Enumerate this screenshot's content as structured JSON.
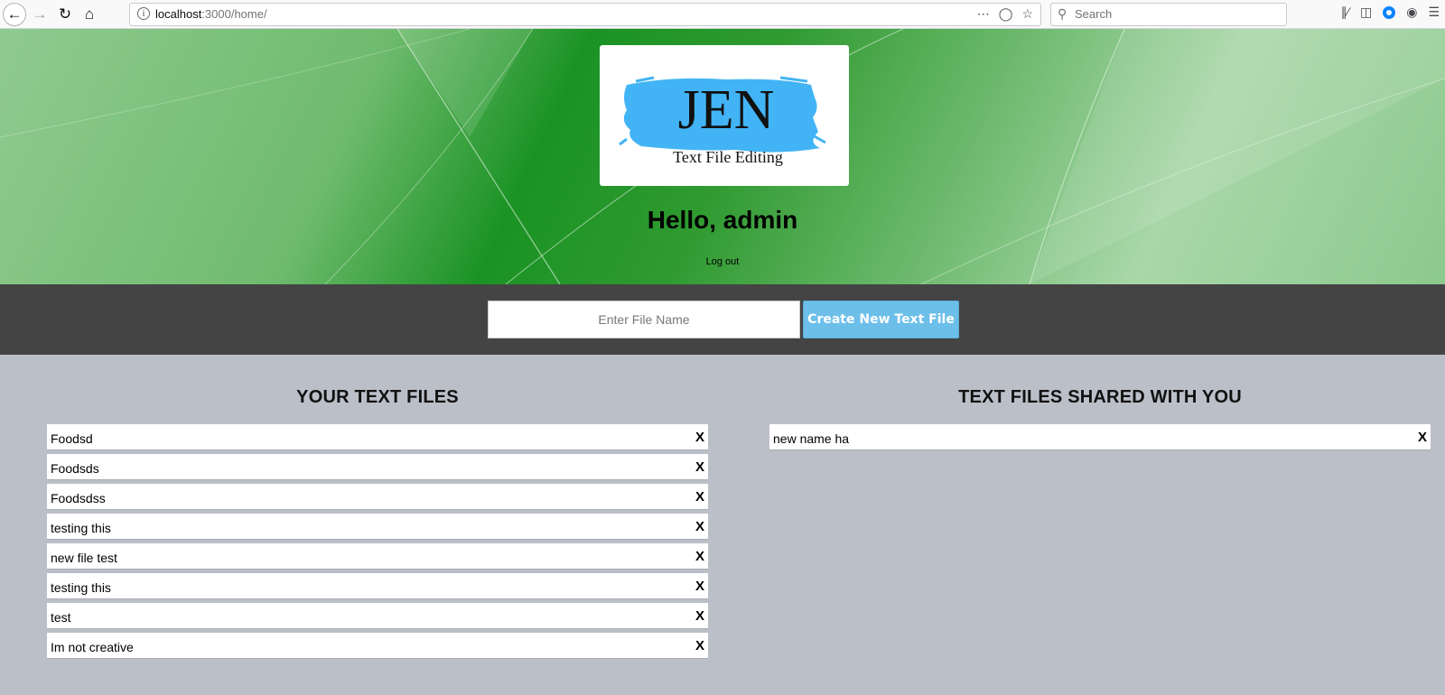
{
  "browser": {
    "url_host": "localhost",
    "url_path": ":3000/home/",
    "search_placeholder": "Search"
  },
  "hero": {
    "logo_main": "JEN",
    "logo_sub": "Text File Editing",
    "greeting": "Hello, admin",
    "logout_label": "Log out"
  },
  "create": {
    "input_placeholder": "Enter File Name",
    "button_label": "Create New Text File"
  },
  "your_files": {
    "heading": "YOUR TEXT FILES",
    "items": [
      {
        "name": "Foodsd",
        "delete": "X"
      },
      {
        "name": "Foodsds",
        "delete": "X"
      },
      {
        "name": "Foodsdss",
        "delete": "X"
      },
      {
        "name": "testing this",
        "delete": "X"
      },
      {
        "name": "new file test",
        "delete": "X"
      },
      {
        "name": "testing this",
        "delete": "X"
      },
      {
        "name": "test",
        "delete": "X"
      },
      {
        "name": "Im not creative",
        "delete": "X"
      }
    ]
  },
  "shared_files": {
    "heading": "TEXT FILES SHARED WITH YOU",
    "items": [
      {
        "name": "new name ha",
        "delete": "X"
      }
    ]
  },
  "colors": {
    "accent": "#6cbfe9",
    "logo_brush": "#42b4f5",
    "create_bar": "#444444",
    "page_bg": "#bbbfc8"
  }
}
